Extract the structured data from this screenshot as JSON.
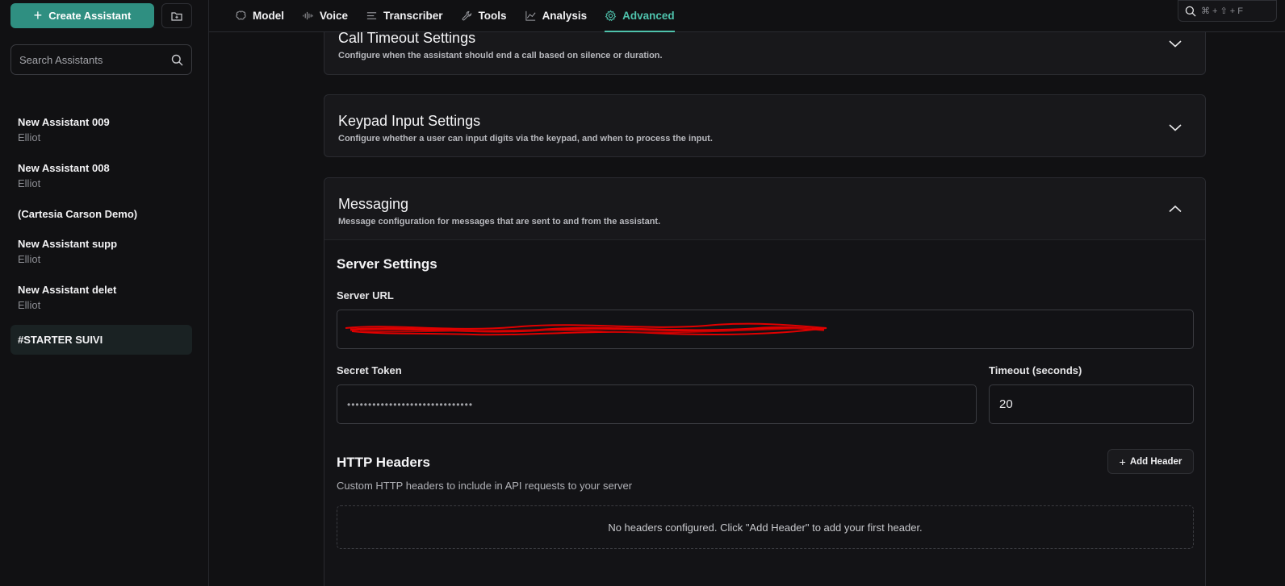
{
  "sidebar": {
    "create_label": "Create Assistant",
    "search_placeholder": "Search Assistants",
    "assistants": [
      {
        "name": "New Assistant 009",
        "owner": "Elliot"
      },
      {
        "name": "New Assistant 008",
        "owner": "Elliot"
      },
      {
        "name": "(Cartesia Carson Demo)",
        "owner": ""
      },
      {
        "name": "New Assistant supp",
        "owner": "Elliot"
      },
      {
        "name": "New Assistant delet",
        "owner": "Elliot"
      },
      {
        "name": "#STARTER SUIVI",
        "owner": ""
      }
    ]
  },
  "tabs": [
    {
      "label": "Model",
      "icon": "brain-icon"
    },
    {
      "label": "Voice",
      "icon": "waveform-icon"
    },
    {
      "label": "Transcriber",
      "icon": "lines-icon"
    },
    {
      "label": "Tools",
      "icon": "wrench-icon"
    },
    {
      "label": "Analysis",
      "icon": "chart-line-icon"
    },
    {
      "label": "Advanced",
      "icon": "gear-icon",
      "active": true
    }
  ],
  "shortcut": "⌘ + ⇧ + F",
  "panels": {
    "call_timeout": {
      "title": "Call Timeout Settings",
      "desc": "Configure when the assistant should end a call based on silence or duration."
    },
    "keypad": {
      "title": "Keypad Input Settings",
      "desc": "Configure whether a user can input digits via the keypad, and when to process the input."
    },
    "messaging": {
      "title": "Messaging",
      "desc": "Message configuration for messages that are sent to and from the assistant."
    }
  },
  "server": {
    "section_title": "Server Settings",
    "url_label": "Server URL",
    "url_value": "",
    "secret_label": "Secret Token",
    "secret_value": "••••••••••••••••••••••••••••••",
    "timeout_label": "Timeout (seconds)",
    "timeout_value": "20"
  },
  "http_headers": {
    "title": "HTTP Headers",
    "add_label": "Add Header",
    "desc": "Custom HTTP headers to include in API requests to your server",
    "empty": "No headers configured. Click \"Add Header\" to add your first header."
  },
  "colors": {
    "accent": "#2f8f81",
    "active_tab": "#4fc3ad",
    "redaction": "#e00000"
  }
}
